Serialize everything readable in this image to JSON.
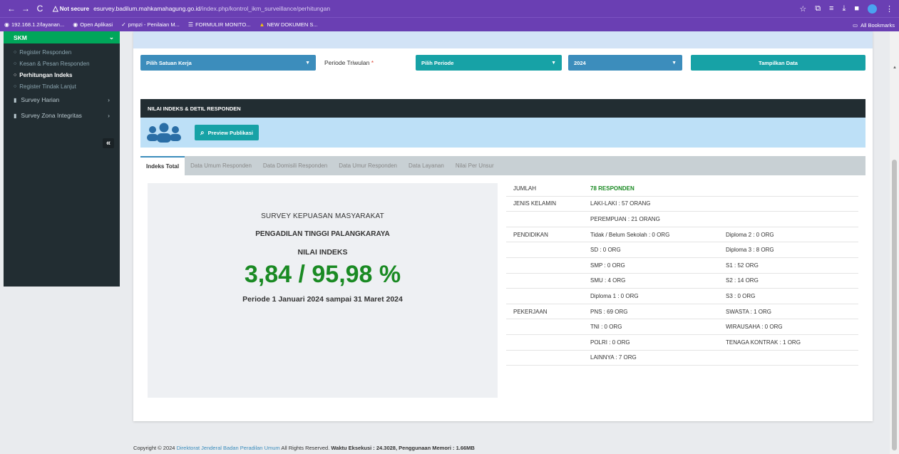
{
  "browser": {
    "not_secure": "Not secure",
    "url_host": "esurvey.badilum.mahkamahagung.go.id",
    "url_path": "/index.php/kontrol_ikm_surveillance/perhitungan",
    "bookmarks": [
      {
        "label": "192.168.1.2/layanan...",
        "icon": "globe-icon"
      },
      {
        "label": "Open Aplikasi",
        "icon": "globe-icon"
      },
      {
        "label": "pmpzi - Penilaian M...",
        "icon": "check-icon"
      },
      {
        "label": "FORMULIR MONITO...",
        "icon": "list-icon"
      },
      {
        "label": "NEW DOKUMEN S...",
        "icon": "drive-icon"
      }
    ],
    "all_bookmarks": "All Bookmarks"
  },
  "sidebar": {
    "header": "SKM",
    "sub_items": [
      {
        "label": "Register Responden",
        "active": false
      },
      {
        "label": "Kesan & Pesan Responden",
        "active": false
      },
      {
        "label": "Perhitungan Indeks",
        "active": true
      },
      {
        "label": "Register Tindak Lanjut",
        "active": false
      }
    ],
    "menus": [
      {
        "label": "Survey Harian"
      },
      {
        "label": "Survey Zona Integritas"
      }
    ]
  },
  "filters": {
    "satuan_kerja": "Pilih Satuan Kerja",
    "periode_label": "Periode Triwulan",
    "periode_required": "*",
    "periode": "Pilih Periode",
    "year": "2024",
    "show_button": "Tampilkan Data"
  },
  "section": {
    "title": "NILAI INDEKS & DETIL RESPONDEN",
    "preview_button": "Preview Publikasi"
  },
  "tabs": [
    {
      "label": "Indeks Total",
      "active": true
    },
    {
      "label": "Data Umum Responden",
      "active": false
    },
    {
      "label": "Data Domisili Responden",
      "active": false
    },
    {
      "label": "Data Umur Responden",
      "active": false
    },
    {
      "label": "Data Layanan",
      "active": false
    },
    {
      "label": "Nilai Per Unsur",
      "active": false
    }
  ],
  "index_panel": {
    "survey_title": "SURVEY KEPUASAN MASYARAKAT",
    "court": "PENGADILAN TINGGI PALANGKARAYA",
    "nilai_label": "NILAI INDEKS",
    "value": "3,84 / 95,98 %",
    "period": "Periode 1 Januari 2024 sampai 31 Maret 2024"
  },
  "stats": [
    {
      "c1": "JUMLAH",
      "c2": "78 RESPONDEN",
      "c3": "",
      "highlight": true
    },
    {
      "c1": "JENIS KELAMIN",
      "c2": "LAKI-LAKI : 57 ORANG",
      "c3": ""
    },
    {
      "c1": "",
      "c2": "PEREMPUAN : 21 ORANG",
      "c3": ""
    },
    {
      "c1": "PENDIDIKAN",
      "c2": "Tidak / Belum Sekolah : 0 ORG",
      "c3": "Diploma 2 : 0 ORG"
    },
    {
      "c1": "",
      "c2": "SD : 0 ORG",
      "c3": "Diploma 3 : 8 ORG"
    },
    {
      "c1": "",
      "c2": "SMP : 0 ORG",
      "c3": "S1 : 52 ORG"
    },
    {
      "c1": "",
      "c2": "SMU : 4 ORG",
      "c3": "S2 : 14 ORG"
    },
    {
      "c1": "",
      "c2": "Diploma 1 : 0 ORG",
      "c3": "S3 : 0 ORG"
    },
    {
      "c1": "PEKERJAAN",
      "c2": "PNS : 69 ORG",
      "c3": "SWASTA : 1 ORG"
    },
    {
      "c1": "",
      "c2": "TNI : 0 ORG",
      "c3": "WIRAUSAHA : 0 ORG"
    },
    {
      "c1": "",
      "c2": "POLRI : 0 ORG",
      "c3": "TENAGA KONTRAK : 1 ORG"
    },
    {
      "c1": "",
      "c2": "LAINNYA : 7 ORG",
      "c3": ""
    }
  ],
  "footer": {
    "prefix": "Copyright © 2024",
    "link": "Direktorat Jenderal Badan Peradilan Umum",
    "rights": "All Rights Reserved.",
    "exec": "Waktu Eksekusi : 24.3028, Penggunaan Memori : 1.66MB"
  },
  "colors": {
    "accent": "#17a2a6",
    "success": "#1a8a23",
    "chrome": "#6a3fb3",
    "sidebar": "#222d32"
  }
}
